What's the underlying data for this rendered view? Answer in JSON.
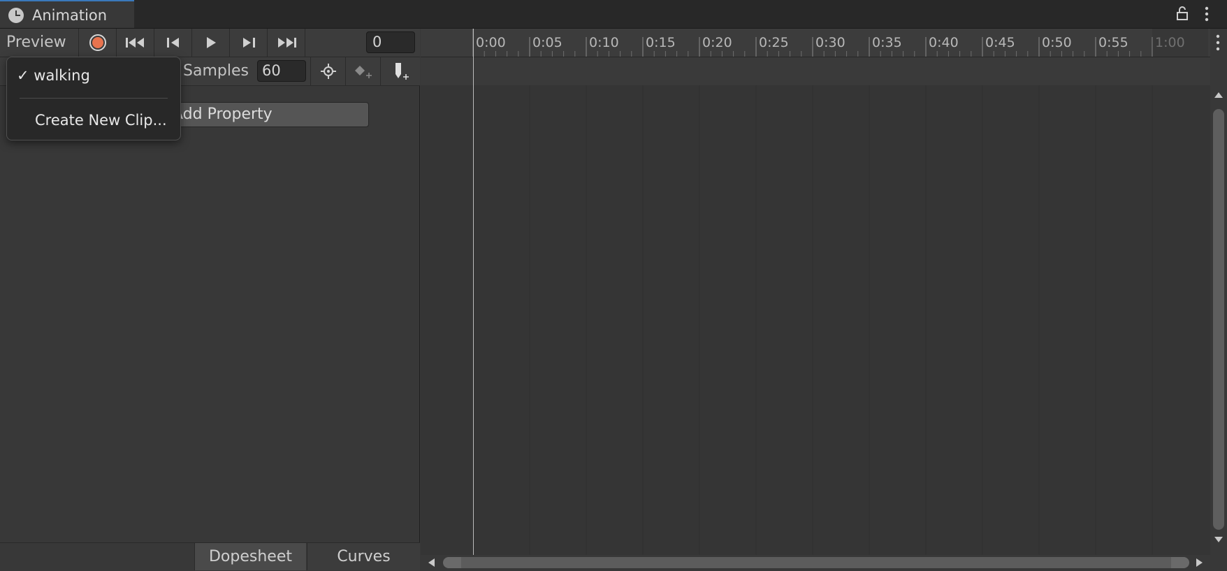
{
  "window": {
    "tab_title": "Animation",
    "tab_icon": "clock-icon"
  },
  "toolbar": {
    "preview_label": "Preview",
    "record_color": "#e8734e",
    "frame_value": "0"
  },
  "clip_toolbar": {
    "samples_label": "Samples",
    "samples_value": "60"
  },
  "properties": {
    "add_property_label": "Add Property"
  },
  "clip_dropdown": {
    "items": [
      {
        "label": "walking",
        "checked": true
      },
      {
        "label": "Create New Clip..."
      }
    ]
  },
  "timeline": {
    "ticks": [
      "0:00",
      "0:05",
      "0:10",
      "0:15",
      "0:20",
      "0:25",
      "0:30",
      "0:35",
      "0:40",
      "0:45",
      "0:50",
      "0:55",
      "1:00"
    ]
  },
  "bottom_tabs": {
    "dopesheet": "Dopesheet",
    "curves": "Curves"
  },
  "colors": {
    "accent_tab": "#3a79bb",
    "background": "#383838"
  }
}
